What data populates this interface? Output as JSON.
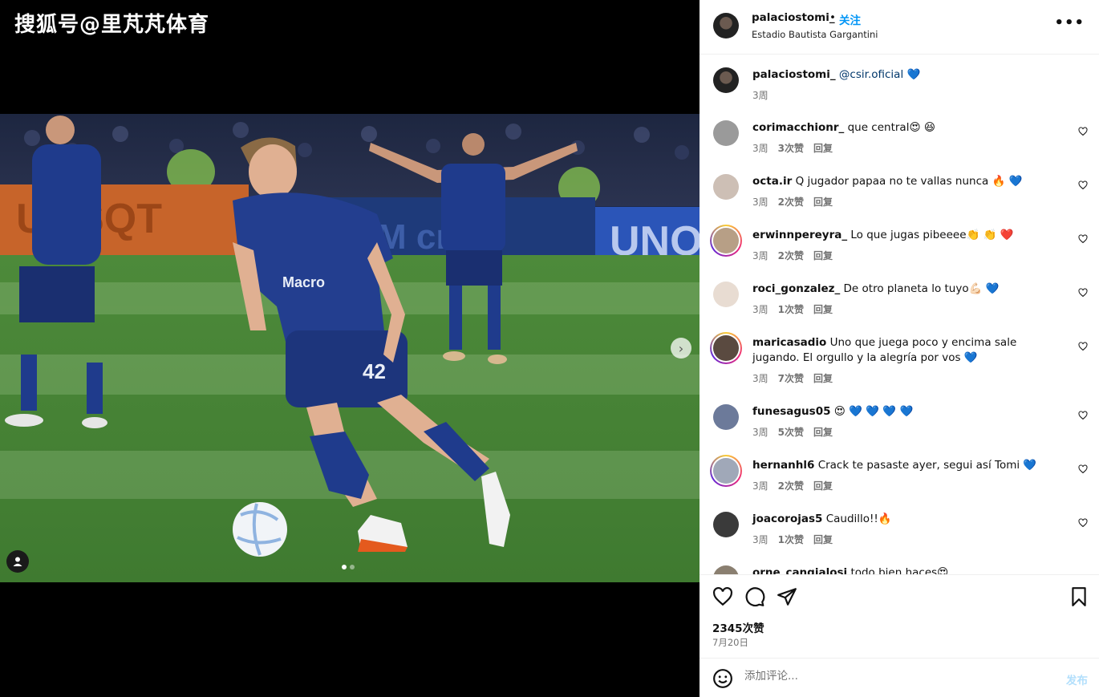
{
  "watermark": "搜狐号@里芃芃体育",
  "post": {
    "username": "palaciostomi_",
    "separator": "•",
    "follow_label": "关注",
    "location": "Estadio Bautista Gargantini",
    "more_icon": "more-horizontal-icon",
    "caption": {
      "username": "palaciostomi_",
      "mention": "@csir.oficial",
      "emoji": "💙",
      "time": "3周"
    },
    "likes": "2345次赞",
    "date": "7月20日",
    "carousel": {
      "current": 1,
      "total": 2
    }
  },
  "comments": [
    {
      "username": "corimacchionr_",
      "text": "que central😍 😆",
      "time": "3周",
      "likes": "3次赞",
      "reply": "回复",
      "story_ring": false
    },
    {
      "username": "octa.ir",
      "text": "Q jugador papaa no te vallas nunca 🔥 💙",
      "time": "3周",
      "likes": "2次赞",
      "reply": "回复",
      "story_ring": false
    },
    {
      "username": "erwinnpereyra_",
      "text": "Lo que jugas pibeeee👏 👏 ❤️",
      "time": "3周",
      "likes": "2次赞",
      "reply": "回复",
      "story_ring": true
    },
    {
      "username": "roci_gonzalez_",
      "text": "De otro planeta lo tuyo💪🏻 💙",
      "time": "3周",
      "likes": "1次赞",
      "reply": "回复",
      "story_ring": false
    },
    {
      "username": "maricasadio",
      "text": "Uno que juega poco y encima sale jugando. El orgullo y la alegría por vos 💙",
      "time": "3周",
      "likes": "7次赞",
      "reply": "回复",
      "story_ring": true
    },
    {
      "username": "funesagus05",
      "text": "😍 💙 💙 💙 💙",
      "time": "3周",
      "likes": "5次赞",
      "reply": "回复",
      "story_ring": false
    },
    {
      "username": "hernanhl6",
      "text": "Crack te pasaste ayer, segui así Tomi 💙",
      "time": "3周",
      "likes": "2次赞",
      "reply": "回复",
      "story_ring": true
    },
    {
      "username": "joacorojas5",
      "text": "Caudillo!!🔥",
      "time": "3周",
      "likes": "1次赞",
      "reply": "回复",
      "story_ring": false
    },
    {
      "username": "orne_cangialosi",
      "text": "todo bien haces😍",
      "time": "",
      "likes": "",
      "reply": "",
      "story_ring": false
    }
  ],
  "composer": {
    "placeholder": "添加评论...",
    "post_label": "发布"
  },
  "icons": {
    "like": "heart-icon",
    "comment": "comment-icon",
    "share": "share-icon",
    "save": "bookmark-icon",
    "emoji": "emoji-icon",
    "next": "chevron-right-icon",
    "tagged": "user-tag-icon"
  },
  "colors": {
    "accent": "#0095f6",
    "mention": "#00376b",
    "muted": "#737373",
    "post_disabled": "#b2dffc"
  }
}
